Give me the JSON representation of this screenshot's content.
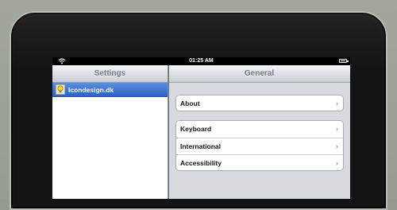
{
  "status_bar": {
    "time": "01:25 AM"
  },
  "master": {
    "title": "Settings",
    "items": [
      {
        "label": "Icondesign.dk",
        "icon": "lightbulb-icon",
        "selected": true
      }
    ]
  },
  "detail": {
    "title": "General",
    "groups": [
      {
        "rows": [
          {
            "label": "About"
          }
        ]
      },
      {
        "rows": [
          {
            "label": "Keyboard"
          },
          {
            "label": "International"
          },
          {
            "label": "Accessibility"
          }
        ]
      }
    ],
    "chevron": "›"
  },
  "colors": {
    "selection_blue": "#2c62c4",
    "nav_text": "#6f7782",
    "backdrop": "#959a90"
  }
}
